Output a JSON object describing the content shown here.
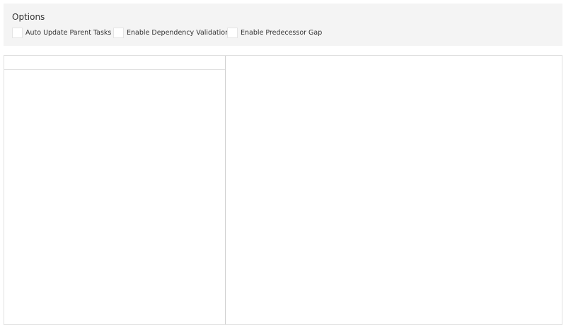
{
  "options": {
    "title": "Options",
    "checkboxes": [
      {
        "label": "Auto Update Parent Tasks",
        "checked": false
      },
      {
        "label": "Enable Dependency Validation",
        "checked": false
      },
      {
        "label": "Enable Predecessor Gap",
        "checked": false
      }
    ]
  }
}
